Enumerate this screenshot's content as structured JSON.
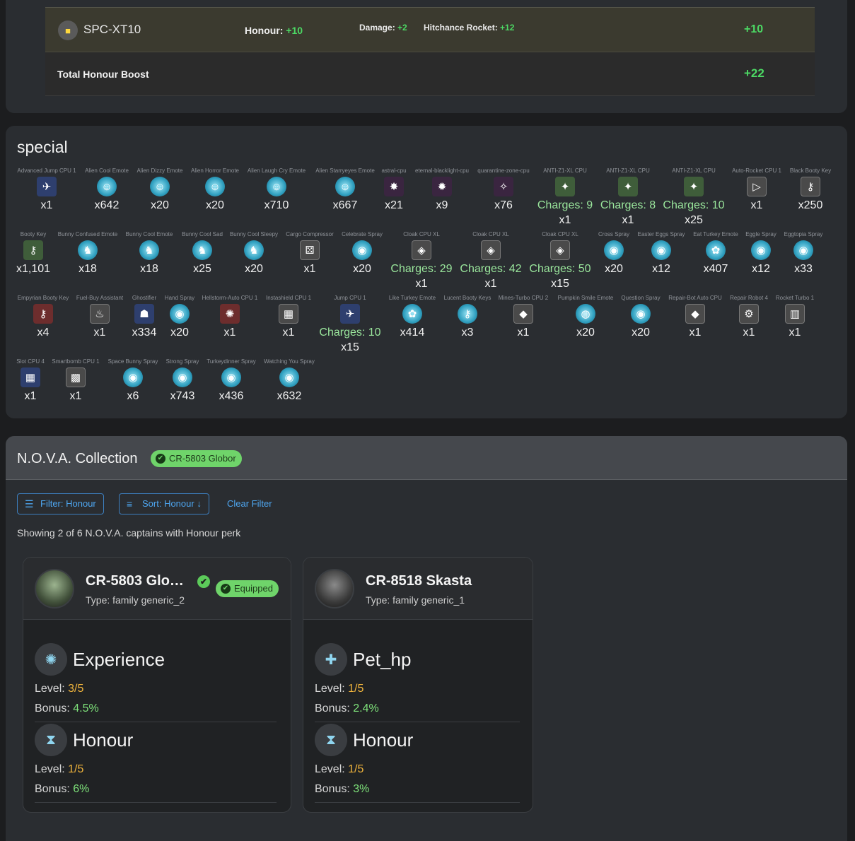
{
  "boost": {
    "item_name": "SPC-XT10",
    "honour_label": "Honour:",
    "honour_value": "+10",
    "stat1_label": "Damage:",
    "stat1_value": "+2",
    "stat2_label": "Hitchance Rocket:",
    "stat2_value": "+12",
    "row_total": "+10",
    "total_label": "Total Honour Boost",
    "total_value": "+22"
  },
  "special": {
    "title": "special",
    "items": [
      {
        "label": "Advanced Jump CPU 1",
        "count": "x1",
        "icon": "jump-cpu-icon"
      },
      {
        "label": "Alien Cool Emote",
        "count": "x642",
        "icon": "alien-emote-icon"
      },
      {
        "label": "Alien Dizzy Emote",
        "count": "x20",
        "icon": "alien-emote-icon"
      },
      {
        "label": "Alien Horror Emote",
        "count": "x20",
        "icon": "alien-emote-icon"
      },
      {
        "label": "Alien Laugh Cry Emote",
        "count": "x710",
        "icon": "alien-emote-icon"
      },
      {
        "label": "Alien Starryeyes Emote",
        "count": "x667",
        "icon": "alien-emote-icon"
      },
      {
        "label": "astral-cpu",
        "count": "x21",
        "icon": "astral-cpu-icon"
      },
      {
        "label": "eternal-blacklight-cpu",
        "count": "x9",
        "icon": "blacklight-cpu-icon"
      },
      {
        "label": "quarantine-zone-cpu",
        "count": "x76",
        "icon": "quarantine-cpu-icon"
      },
      {
        "label": "ANTI-Z1-XL CPU",
        "charges": "Charges: 9",
        "count": "x1",
        "icon": "anti-z1-cpu-icon"
      },
      {
        "label": "ANTI-Z1-XL CPU",
        "charges": "Charges: 8",
        "count": "x1",
        "icon": "anti-z1-cpu-icon"
      },
      {
        "label": "ANTI-Z1-XL CPU",
        "charges": "Charges: 10",
        "count": "x25",
        "icon": "anti-z1-cpu-icon"
      },
      {
        "label": "Auto-Rocket CPU 1",
        "count": "x1",
        "icon": "auto-rocket-cpu-icon"
      },
      {
        "label": "Black Booty Key",
        "count": "x250",
        "icon": "black-key-icon"
      },
      {
        "label": "Booty Key",
        "count": "x1,101",
        "icon": "booty-key-icon"
      },
      {
        "label": "Bunny Confused Emote",
        "count": "x18",
        "icon": "bunny-emote-icon"
      },
      {
        "label": "Bunny Cool Emote",
        "count": "x18",
        "icon": "bunny-emote-icon"
      },
      {
        "label": "Bunny Cool Sad",
        "count": "x25",
        "icon": "bunny-emote-icon"
      },
      {
        "label": "Bunny Cool Sleepy",
        "count": "x20",
        "icon": "bunny-emote-icon"
      },
      {
        "label": "Cargo Compressor",
        "count": "x1",
        "icon": "cargo-compressor-icon"
      },
      {
        "label": "Celebrate Spray",
        "count": "x20",
        "icon": "spray-icon"
      },
      {
        "label": "Cloak CPU XL",
        "charges": "Charges: 29",
        "count": "x1",
        "icon": "cloak-cpu-icon"
      },
      {
        "label": "Cloak CPU XL",
        "charges": "Charges: 42",
        "count": "x1",
        "icon": "cloak-cpu-icon"
      },
      {
        "label": "Cloak CPU XL",
        "charges": "Charges: 50",
        "count": "x15",
        "icon": "cloak-cpu-icon"
      },
      {
        "label": "Cross Spray",
        "count": "x20",
        "icon": "spray-icon"
      },
      {
        "label": "Easter Eggs Spray",
        "count": "x12",
        "icon": "spray-icon"
      },
      {
        "label": "Eat Turkey Emote",
        "count": "x407",
        "icon": "turkey-emote-icon"
      },
      {
        "label": "Eggle Spray",
        "count": "x12",
        "icon": "spray-icon"
      },
      {
        "label": "Eggtopia Spray",
        "count": "x33",
        "icon": "spray-icon"
      },
      {
        "label": "Empyrian Booty Key",
        "count": "x4",
        "icon": "empyrian-key-icon"
      },
      {
        "label": "Fuel-Buy Assistant",
        "count": "x1",
        "icon": "fuel-assistant-icon"
      },
      {
        "label": "Ghostifier",
        "count": "x334",
        "icon": "ghostifier-icon"
      },
      {
        "label": "Hand Spray",
        "count": "x20",
        "icon": "spray-icon"
      },
      {
        "label": "Hellstorm-Auto CPU 1",
        "count": "x1",
        "icon": "hellstorm-cpu-icon"
      },
      {
        "label": "Instashield CPU 1",
        "count": "x1",
        "icon": "instashield-cpu-icon"
      },
      {
        "label": "Jump CPU 1",
        "charges": "Charges: 10",
        "count": "x15",
        "icon": "jump-cpu-icon"
      },
      {
        "label": "Like Turkey Emote",
        "count": "x414",
        "icon": "turkey-emote-icon"
      },
      {
        "label": "Lucent Booty Keys",
        "count": "x3",
        "icon": "lucent-key-icon"
      },
      {
        "label": "Mines-Turbo CPU 2",
        "count": "x1",
        "icon": "mines-cpu-icon"
      },
      {
        "label": "Pumpkin Smile Emote",
        "count": "x20",
        "icon": "pumpkin-emote-icon"
      },
      {
        "label": "Question Spray",
        "count": "x20",
        "icon": "spray-icon"
      },
      {
        "label": "Repair-Bot Auto CPU",
        "count": "x1",
        "icon": "repair-cpu-icon"
      },
      {
        "label": "Repair Robot 4",
        "count": "x1",
        "icon": "repair-robot-icon"
      },
      {
        "label": "Rocket Turbo 1",
        "count": "x1",
        "icon": "rocket-turbo-icon"
      },
      {
        "label": "Slot CPU 4",
        "count": "x1",
        "icon": "slot-cpu-icon"
      },
      {
        "label": "Smartbomb CPU 1",
        "count": "x1",
        "icon": "smartbomb-cpu-icon"
      },
      {
        "label": "Space Bunny Spray",
        "count": "x6",
        "icon": "spray-icon"
      },
      {
        "label": "Strong Spray",
        "count": "x743",
        "icon": "spray-icon"
      },
      {
        "label": "Turkeydinner Spray",
        "count": "x436",
        "icon": "spray-icon"
      },
      {
        "label": "Watching You Spray",
        "count": "x632",
        "icon": "spray-icon"
      }
    ]
  },
  "nova": {
    "title": "N.O.V.A. Collection",
    "equipped_chip": "CR-5803 Globor",
    "filter_label": "Filter: Honour",
    "sort_label": "Sort: Honour ↓",
    "clear_label": "Clear Filter",
    "showing": "Showing 2 of 6 N.O.V.A. captains with Honour perk",
    "level_label": "Level:",
    "bonus_label": "Bonus:",
    "cards": [
      {
        "name": "CR-5803 Glo…",
        "type": "Type: family generic_2",
        "equipped": "Equipped",
        "perks": [
          {
            "name": "Experience",
            "level": "3/5",
            "bonus": "4.5%",
            "icon": "gear-icon"
          },
          {
            "name": "Honour",
            "level": "1/5",
            "bonus": "6%",
            "icon": "honour-icon"
          }
        ]
      },
      {
        "name": "CR-8518 Skasta",
        "type": "Type: family generic_1",
        "perks": [
          {
            "name": "Pet_hp",
            "level": "1/5",
            "bonus": "2.4%",
            "icon": "plus-icon"
          },
          {
            "name": "Honour",
            "level": "1/5",
            "bonus": "3%",
            "icon": "honour-icon"
          }
        ]
      }
    ]
  },
  "colors": {
    "accent_green": "#4cd964",
    "link_blue": "#4ea6f0",
    "level_yellow": "#f0b43c"
  }
}
